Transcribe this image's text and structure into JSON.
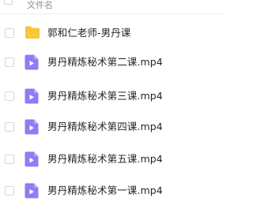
{
  "header": {
    "column_name": "文件名"
  },
  "files": [
    {
      "name": "郭和仁老师-男丹课",
      "icon": "folder-icon",
      "type": "folder"
    },
    {
      "name": "男丹精炼秘术第二课.mp4",
      "icon": "video-file-icon",
      "type": "video"
    },
    {
      "name": "男丹精炼秘术第三课.mp4",
      "icon": "video-file-icon",
      "type": "video"
    },
    {
      "name": "男丹精炼秘术第四课.mp4",
      "icon": "video-file-icon",
      "type": "video"
    },
    {
      "name": "男丹精炼秘术第五课.mp4",
      "icon": "video-file-icon",
      "type": "video"
    },
    {
      "name": "男丹精炼秘术第一课.mp4",
      "icon": "video-file-icon",
      "type": "video"
    }
  ],
  "colors": {
    "folder": "#f8c73d",
    "video": "#8c7ef4",
    "text": "#1f2329",
    "muted": "#8a8f99"
  }
}
